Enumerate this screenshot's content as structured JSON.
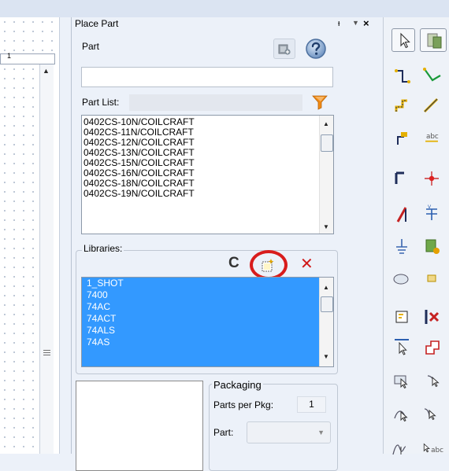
{
  "canvas": {
    "ruler_label": "1"
  },
  "panel": {
    "title": "Place Part",
    "pin_glyph": "ᵻ",
    "menu_glyph": "▼",
    "close_glyph": "×",
    "part_label": "Part",
    "part_value": "",
    "part_list_label": "Part List:",
    "part_list": [
      "0402CS-10N/COILCRAFT",
      "0402CS-11N/COILCRAFT",
      "0402CS-12N/COILCRAFT",
      "0402CS-13N/COILCRAFT",
      "0402CS-15N/COILCRAFT",
      "0402CS-16N/COILCRAFT",
      "0402CS-18N/COILCRAFT",
      "0402CS-19N/COILCRAFT"
    ],
    "libraries_label": "Libraries:",
    "refresh_glyph": "C",
    "remove_glyph": "✕",
    "libraries": [
      "1_SHOT",
      "7400",
      "74AC",
      "74ACT",
      "74ALS",
      "74AS"
    ],
    "packaging_label": "Packaging",
    "parts_per_pkg_label": "Parts per Pkg:",
    "parts_per_pkg_value": "1",
    "pkg_part_label": "Part:",
    "pkg_part_value": ""
  },
  "toolbar": {
    "icons": [
      "select-icon",
      "select-alt-icon",
      "wire-icon",
      "auto-wire-icon",
      "bus-icon",
      "bus-entry-icon",
      "net-alias-icon",
      "text-icon",
      "junction-icon",
      "place-net-icon",
      "power-icon",
      "offpage-icon",
      "ground-icon",
      "hierarchical-block-icon",
      "ellipse-icon",
      "hierarchical-port-icon",
      "no-connect-icon",
      "hierarchical-pin-icon",
      "port-icon",
      "place-pin-icon",
      "rotate-icon",
      "mirror-icon",
      "bezier-icon",
      "text-box-icon"
    ],
    "text_icon_label": "abc"
  },
  "colors": {
    "selection": "#3399ff",
    "highlight": "#d81c1c",
    "panel_bg": "#ecf1f9"
  }
}
